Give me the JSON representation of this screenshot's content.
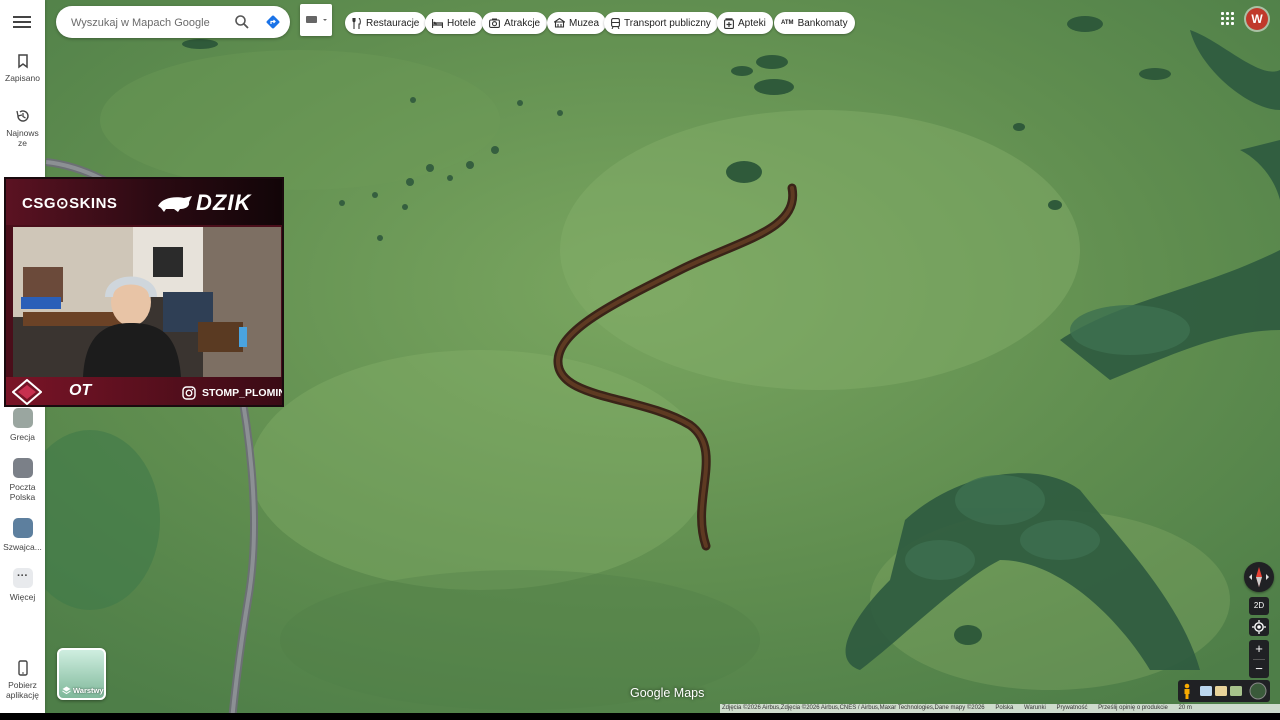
{
  "search": {
    "placeholder": "Wyszukaj w Mapach Google"
  },
  "rail": {
    "saved": "Zapisano",
    "recent": "Najnowsze",
    "recents": [
      {
        "label": "Grecja",
        "thumb_color": "#9aa6a0"
      },
      {
        "label": "Poczta Polska",
        "thumb_color": "#7b8088"
      },
      {
        "label": "Szwajca...",
        "thumb_color": "#5d7f9e"
      }
    ],
    "more": "Więcej",
    "more_glyph": "···",
    "app": "Pobierz aplikację"
  },
  "chips": [
    {
      "label": "Restauracje",
      "icon": "restaurant-icon"
    },
    {
      "label": "Hotele",
      "icon": "hotel-icon"
    },
    {
      "label": "Atrakcje",
      "icon": "camera-icon"
    },
    {
      "label": "Muzea",
      "icon": "museum-icon"
    },
    {
      "label": "Transport publiczny",
      "icon": "transit-icon"
    },
    {
      "label": "Apteki",
      "icon": "pharmacy-icon"
    },
    {
      "label": "Bankomaty",
      "icon": "atm-icon"
    }
  ],
  "account": {
    "initial": "W",
    "color": "#c0392b"
  },
  "stream": {
    "sponsor": "CSG⊙SKINS",
    "brand": "DZIK",
    "badge": "OT",
    "handle": "STOMP_PLOMINSKI"
  },
  "map": {
    "layers_label": "Warstwy",
    "view_2d": "2D",
    "zoom_in": "+",
    "zoom_out": "−",
    "brand": "Google Maps"
  },
  "footer": {
    "attribution": "Zdjęcia ©2026 Airbus,Zdjęcia ©2026 Airbus,CNES / Airbus,Maxar Technologies,Dane mapy ©2026",
    "country": "Polska",
    "terms": "Warunki",
    "privacy": "Prywatność",
    "feedback": "Prześlij opinię o produkcie",
    "scale": "20 m"
  }
}
